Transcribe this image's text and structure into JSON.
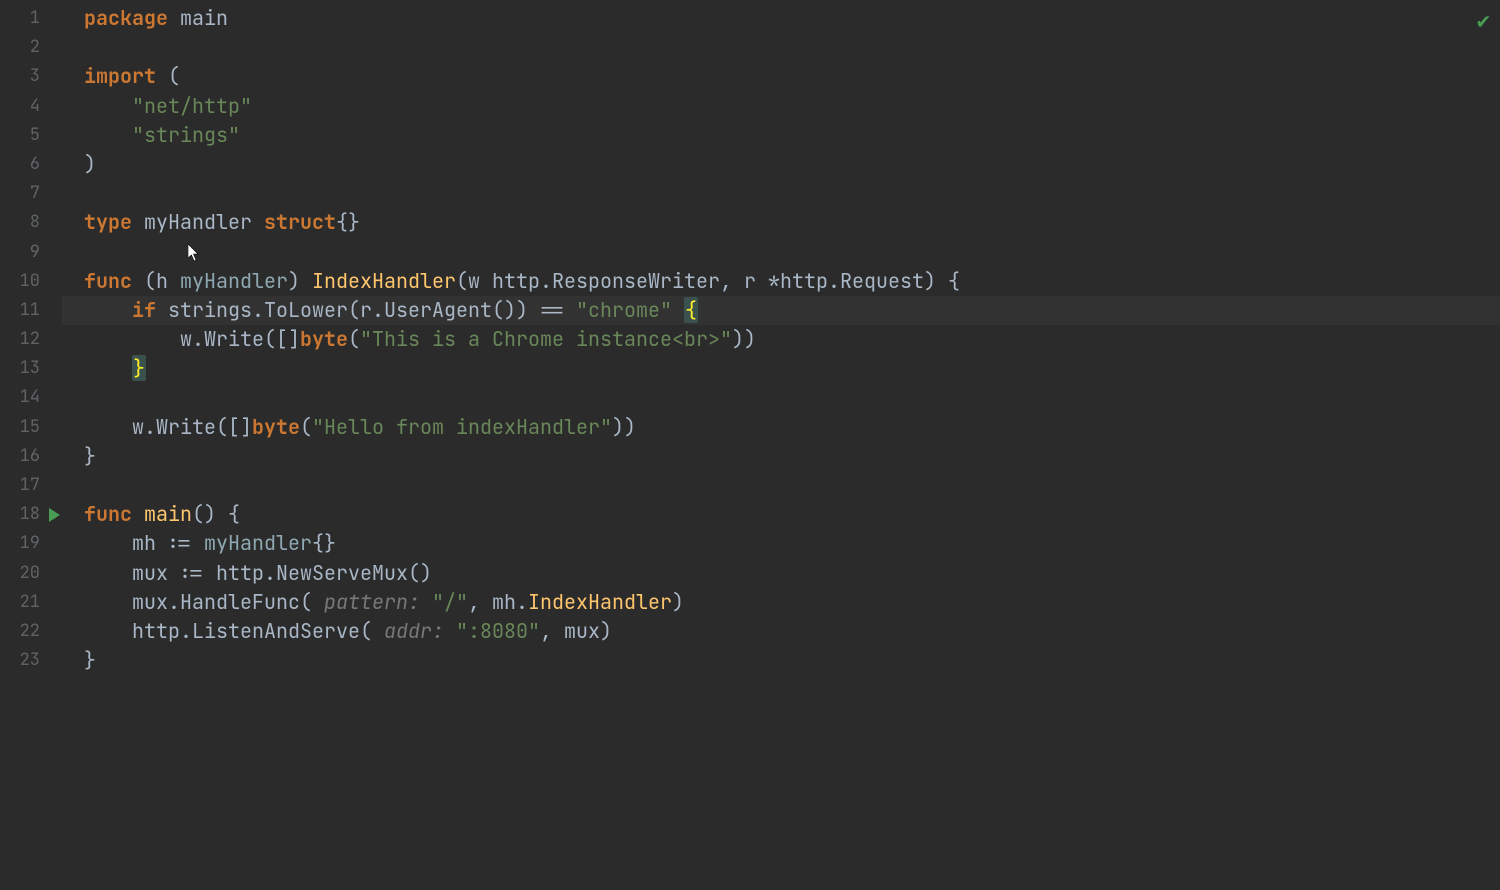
{
  "gutter": {
    "lines": [
      "1",
      "2",
      "3",
      "4",
      "5",
      "6",
      "7",
      "8",
      "9",
      "10",
      "11",
      "12",
      "13",
      "14",
      "15",
      "16",
      "17",
      "18",
      "19",
      "20",
      "21",
      "22",
      "23"
    ],
    "run_marker_line": 18
  },
  "status": {
    "check": "✔"
  },
  "cursor_line": 11,
  "code": {
    "l1": {
      "kw1": "package",
      "sp": " ",
      "id": "main"
    },
    "l3": {
      "kw": "import",
      "rest": " ("
    },
    "l4": {
      "indent": "    ",
      "str": "\"net/http\""
    },
    "l5": {
      "indent": "    ",
      "str": "\"strings\""
    },
    "l6": {
      "txt": ")"
    },
    "l8": {
      "kw1": "type",
      "sp1": " ",
      "id": "myHandler",
      "sp2": " ",
      "kw2": "struct",
      "rest": "{}"
    },
    "l10": {
      "kw": "func",
      "sp": " ",
      "recvOpen": "(h ",
      "recvType": "myHandler",
      "recvClose": ") ",
      "fn": "IndexHandler",
      "params1": "(w ",
      "pkgA": "http",
      "dotA": ".",
      "typA": "ResponseWriter",
      "comma": ", r *",
      "pkgB": "http",
      "dotB": ".",
      "typB": "Request",
      "paramsEnd": ") {"
    },
    "l11": {
      "indent": "    ",
      "kw": "if",
      "sp": " ",
      "expr1": "strings.ToLower(r.UserAgent()) == ",
      "str": "\"chrome\"",
      "sp2": " ",
      "brace": "{"
    },
    "l12": {
      "indent": "        ",
      "call": "w.Write([]",
      "kw": "byte",
      "open": "(",
      "str": "\"This is a Chrome instance<br>\"",
      "close": "))"
    },
    "l13": {
      "indent": "    ",
      "brace": "}"
    },
    "l15": {
      "indent": "    ",
      "call": "w.Write([]",
      "kw": "byte",
      "open": "(",
      "str": "\"Hello from indexHandler\"",
      "close": "))"
    },
    "l16": {
      "txt": "}"
    },
    "l18": {
      "kw": "func",
      "sp": " ",
      "fn": "main",
      "rest": "() {"
    },
    "l19": {
      "indent": "    ",
      "txt1": "mh := ",
      "typ": "myHandler",
      "txt2": "{}"
    },
    "l20": {
      "indent": "    ",
      "txt1": "mux := http.NewServeMux()"
    },
    "l21": {
      "indent": "    ",
      "txt1": "mux.HandleFunc( ",
      "hint": "pattern:",
      "sp": " ",
      "str": "\"/\"",
      "txt2": ", mh.",
      "fn": "IndexHandler",
      "txt3": ")"
    },
    "l22": {
      "indent": "    ",
      "txt1": "http.ListenAndServe( ",
      "hint": "addr:",
      "sp": " ",
      "str": "\":8080\"",
      "txt2": ", mux)"
    },
    "l23": {
      "txt": "}"
    }
  }
}
